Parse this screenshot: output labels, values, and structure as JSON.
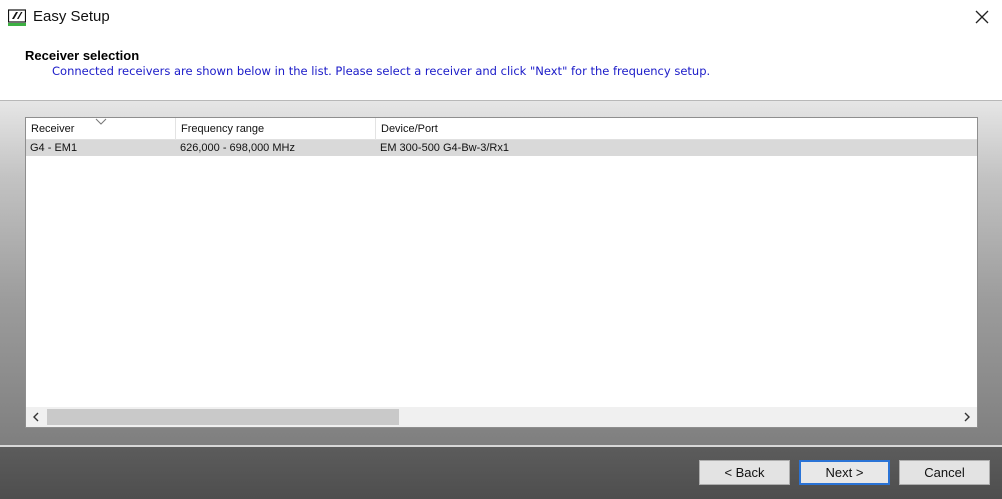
{
  "window": {
    "title": "Easy Setup"
  },
  "header": {
    "title": "Receiver selection",
    "description": "Connected receivers are shown below in the list. Please select a receiver and click \"Next\" for the frequency setup."
  },
  "table": {
    "columns": [
      "Receiver",
      "Frequency range",
      "Device/Port"
    ],
    "rows": [
      [
        "G4 - EM1",
        "626,000 - 698,000 MHz",
        "EM 300-500 G4-Bw-3/Rx1"
      ]
    ]
  },
  "buttons": {
    "back": "< Back",
    "next": "Next >",
    "cancel": "Cancel"
  },
  "icons": {
    "app": "sennheiser-logo-icon",
    "close": "close-icon",
    "sort": "sort-descending-icon",
    "scroll_left": "chevron-left-icon",
    "scroll_right": "chevron-right-icon"
  },
  "colors": {
    "accent": "#2a73d6",
    "description_text": "#1a1ac8",
    "selected_row": "#d9d9d9"
  }
}
